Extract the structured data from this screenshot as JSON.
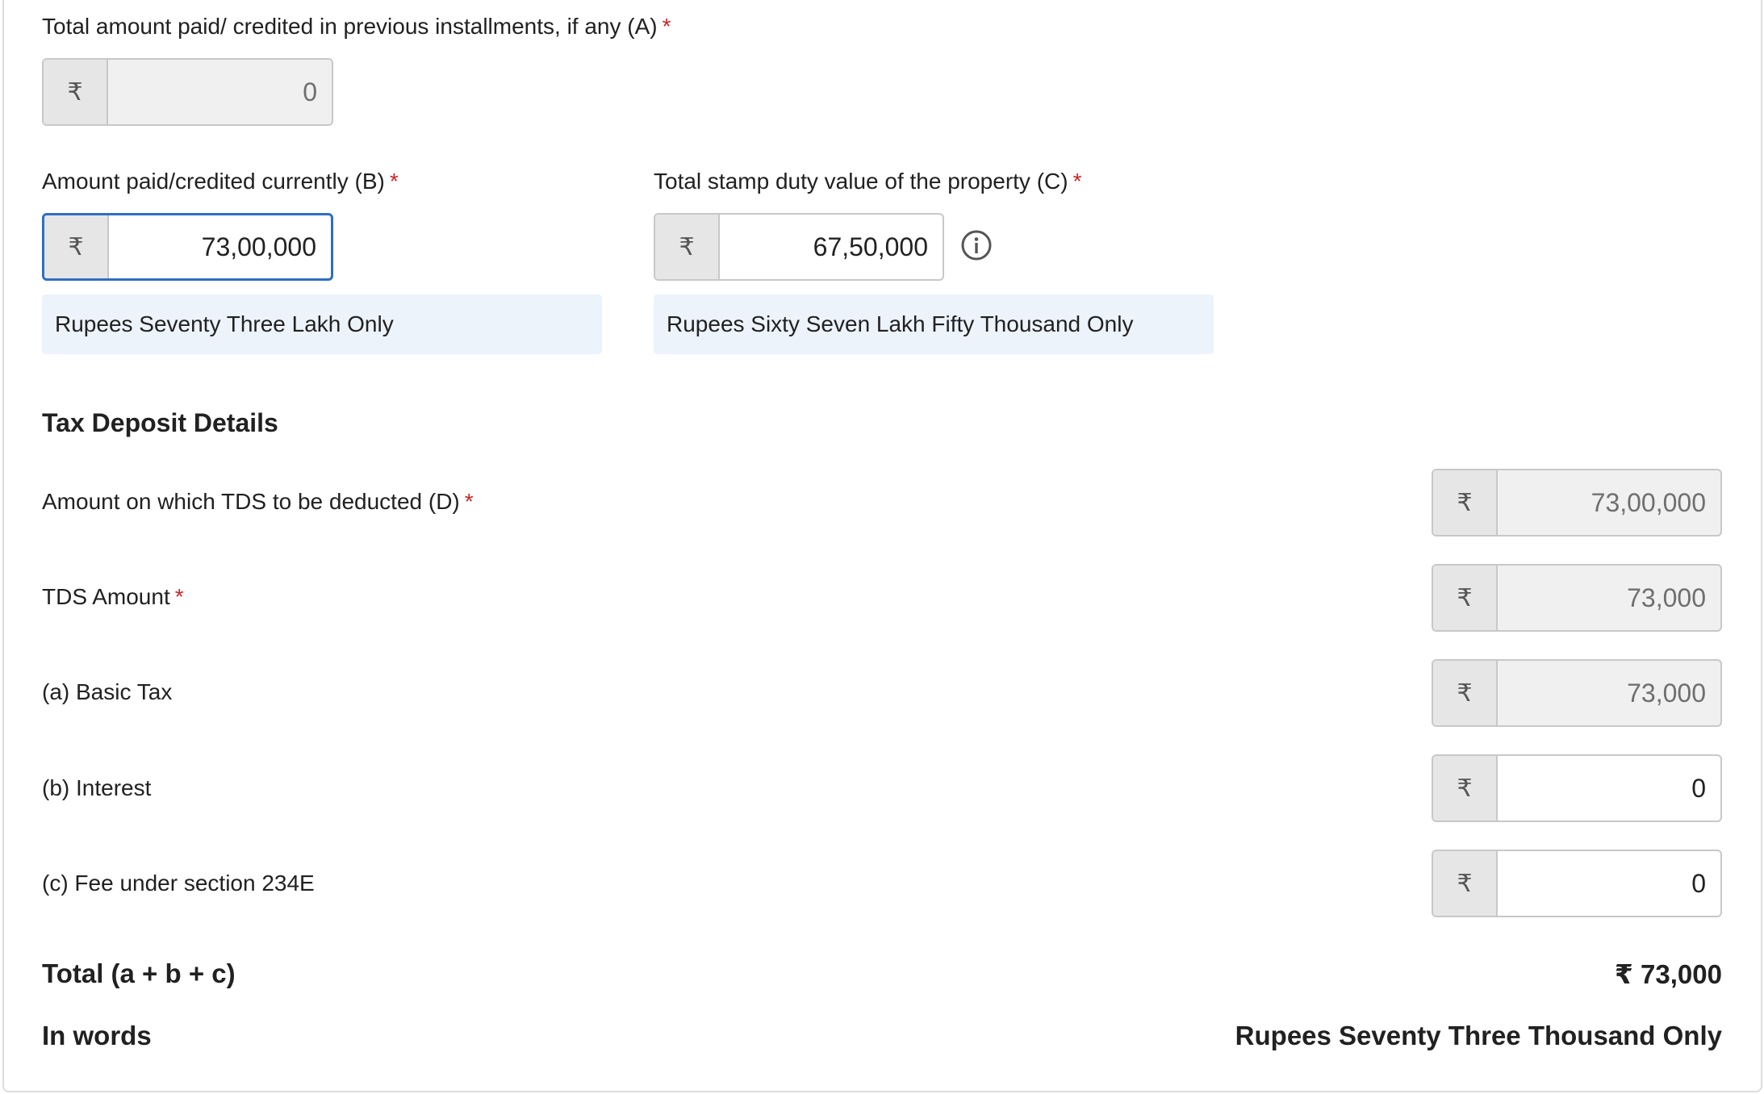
{
  "fields": {
    "prev_installments": {
      "label": "Total amount paid/ credited in previous installments, if any (A)",
      "required_mark": "*",
      "currency_symbol": "₹",
      "value": "0",
      "disabled": true
    },
    "amount_current": {
      "label": "Amount paid/credited currently (B)",
      "required_mark": "*",
      "currency_symbol": "₹",
      "value": "73,00,000",
      "words": "Rupees Seventy Three Lakh Only"
    },
    "stamp_duty": {
      "label": "Total stamp duty value of the property (C)",
      "required_mark": "*",
      "currency_symbol": "₹",
      "value": "67,50,000",
      "words": "Rupees Sixty Seven Lakh Fifty Thousand Only",
      "icon": "info-icon"
    }
  },
  "tax_deposit": {
    "title": "Tax Deposit Details",
    "rows": [
      {
        "label": "Amount on which TDS to be deducted (D)",
        "required_mark": "*",
        "currency_symbol": "₹",
        "value": "73,00,000",
        "disabled": true
      },
      {
        "label": "TDS Amount",
        "required_mark": "*",
        "currency_symbol": "₹",
        "value": "73,000",
        "disabled": true
      },
      {
        "label": "(a) Basic Tax",
        "required_mark": "",
        "currency_symbol": "₹",
        "value": "73,000",
        "disabled": true
      },
      {
        "label": "(b) Interest",
        "required_mark": "",
        "currency_symbol": "₹",
        "value": "0",
        "disabled": false
      },
      {
        "label": "(c) Fee under section 234E",
        "required_mark": "",
        "currency_symbol": "₹",
        "value": "0",
        "disabled": false
      }
    ],
    "total_label": "Total (a + b + c)",
    "total_value": "₹ 73,000",
    "words_label": "In words",
    "words_value": "Rupees Seventy Three Thousand Only"
  },
  "colors": {
    "required": "#c62828",
    "focus_border": "#2f6ec3",
    "words_background": "#edf3fb",
    "disabled_background": "#f0f0f0"
  }
}
